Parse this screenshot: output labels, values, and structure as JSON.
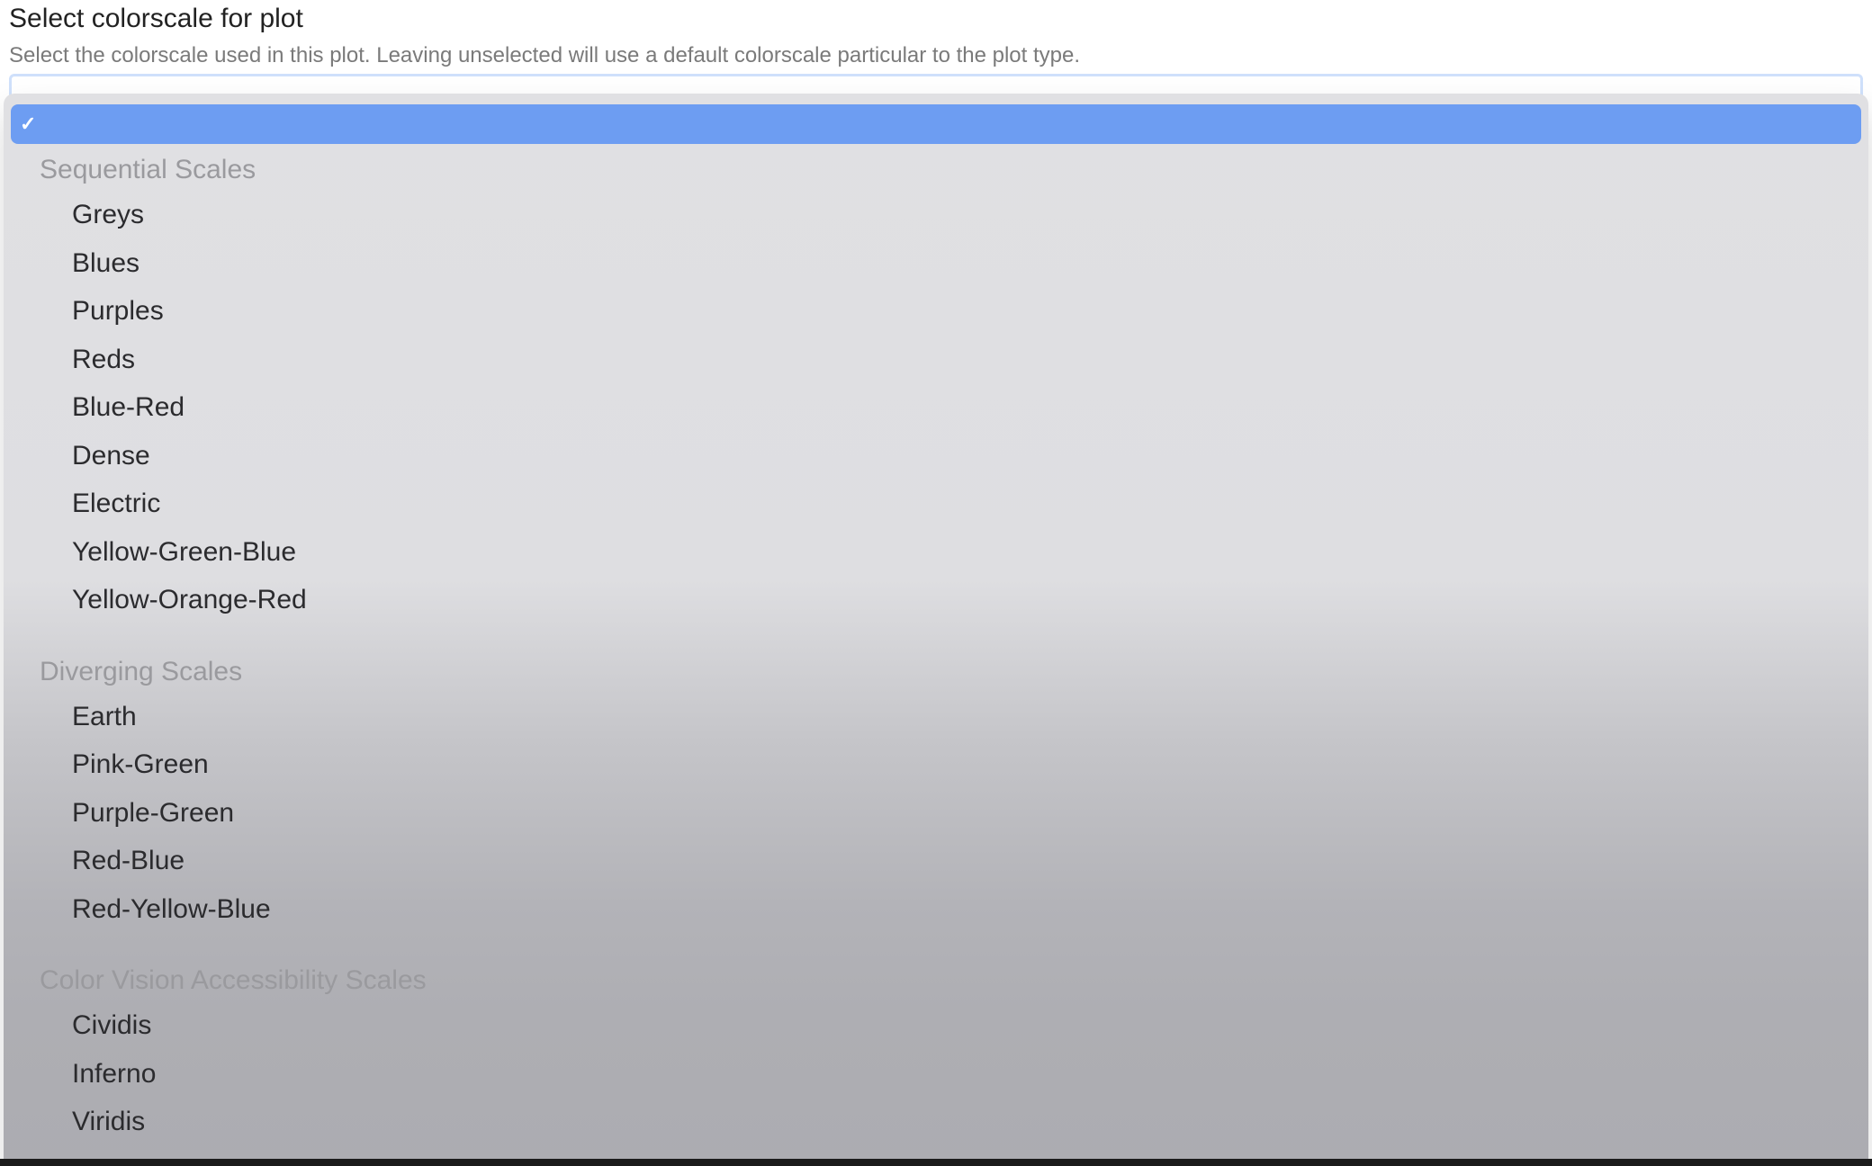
{
  "field": {
    "label": "Select colorscale for plot",
    "description": "Select the colorscale used in this plot. Leaving unselected will use a default colorscale particular to the plot type."
  },
  "dropdown": {
    "selected_value": "",
    "groups": [
      {
        "label": "Sequential Scales",
        "options": [
          "Greys",
          "Blues",
          "Purples",
          "Reds",
          "Blue-Red",
          "Dense",
          "Electric",
          "Yellow-Green-Blue",
          "Yellow-Orange-Red"
        ]
      },
      {
        "label": "Diverging Scales",
        "options": [
          "Earth",
          "Pink-Green",
          "Purple-Green",
          "Red-Blue",
          "Red-Yellow-Blue"
        ]
      },
      {
        "label": "Color Vision Accessibility Scales",
        "options": [
          "Cividis",
          "Inferno",
          "Viridis"
        ]
      }
    ]
  }
}
